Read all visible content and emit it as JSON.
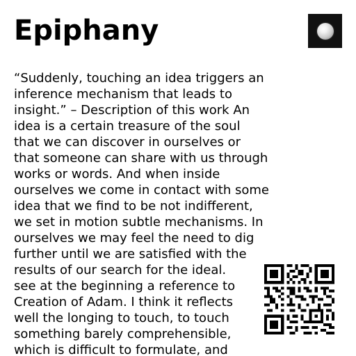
{
  "page": {
    "title": "Epiphany",
    "artwork_thumbnail_icon": "white-sphere-on-black-icon",
    "qr_code_icon": "qr-code-icon",
    "description_lines": [
      "“Suddenly, touching an idea triggers an",
      "inference mechanism that leads to",
      "insight.” – Description of this work An",
      "idea is a certain treasure of the soul",
      "that we can discover in ourselves or",
      "that someone can share with us through",
      "works or words. And when inside",
      "ourselves we come in contact with some",
      "idea that we find to be not indifferent,",
      "we set in motion subtle mechanisms. In",
      "ourselves we may feel the need to dig",
      "further until we are satisfied with the",
      "results of our search for the ideal.",
      "see at the beginning a reference to",
      "Creation of Adam. I think it reflects",
      "well the longing to touch, to touch",
      "something barely comprehensible,",
      "which is difficult to formulate, and"
    ]
  },
  "colors": {
    "background": "#ffffff",
    "text": "#000000",
    "thumbnail_background": "#111111"
  }
}
